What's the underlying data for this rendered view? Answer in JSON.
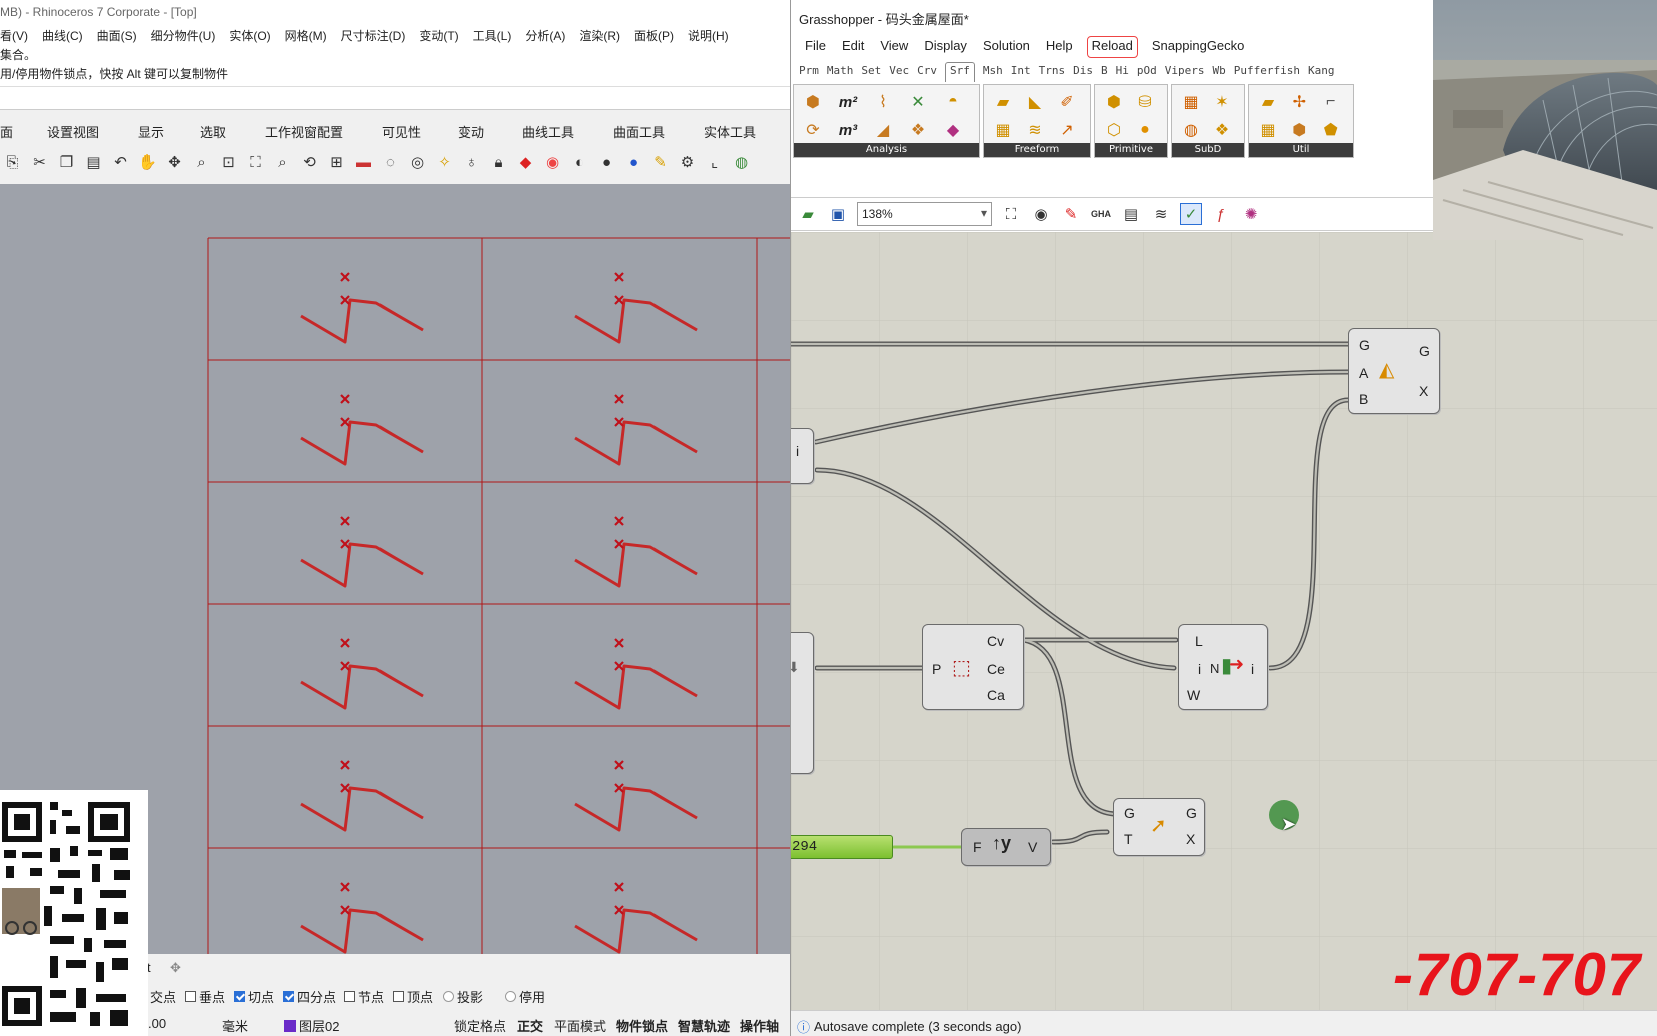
{
  "rhino": {
    "title": "MB) - Rhinoceros 7 Corporate - [Top]",
    "menu": [
      "看(V)",
      "曲线(C)",
      "曲面(S)",
      "细分物件(U)",
      "实体(O)",
      "网格(M)",
      "尺寸标注(D)",
      "变动(T)",
      "工具(L)",
      "分析(A)",
      "渲染(R)",
      "面板(P)",
      "说明(H)"
    ],
    "command_history": [
      "集合。",
      "用/停用物件锁点，快按 Alt 键可以复制物件"
    ],
    "tabs": [
      "面",
      "设置视图",
      "显示",
      "选取",
      "工作视窗配置",
      "可见性",
      "变动",
      "曲线工具",
      "曲面工具",
      "实体工具"
    ],
    "viewport_tab": "t",
    "snaps": [
      {
        "label": "交点",
        "checked": false
      },
      {
        "label": "垂点",
        "checked": false
      },
      {
        "label": "切点",
        "checked": true
      },
      {
        "label": "四分点",
        "checked": true
      },
      {
        "label": "节点",
        "checked": false
      },
      {
        "label": "顶点",
        "checked": false
      },
      {
        "label": "投影",
        "checked": false
      },
      {
        "label": "停用",
        "checked": false
      }
    ],
    "status": {
      "coord": ".00",
      "unit": "毫米",
      "layer": "图层02",
      "layer_color": "#6a2bc8",
      "lock_grid": "锁定格点",
      "ortho": "正交",
      "planar": "平面模式",
      "osnap": "物件锁点",
      "smarttrack": "智慧轨迹",
      "gumball": "操作轴"
    }
  },
  "gh": {
    "title": "Grasshopper - 码头金属屋面*",
    "menu": [
      "File",
      "Edit",
      "View",
      "Display",
      "Solution",
      "Help",
      "Reload",
      "SnappingGecko"
    ],
    "tabs": [
      "Prm",
      "Math",
      "Set",
      "Vec",
      "Crv",
      "Srf",
      "Msh",
      "Int",
      "Trns",
      "Dis",
      "B",
      "Hi",
      "pOd",
      "Vipers",
      "Wb",
      "Pufferfish",
      "Kang"
    ],
    "active_tab": "Srf",
    "panels": [
      "Analysis",
      "Freeform",
      "Primitive",
      "SubD",
      "Util"
    ],
    "zoom": "138%",
    "status": "Autosave complete (3 seconds ago)",
    "components": {
      "c1": {
        "inputs": [
          "G",
          "A",
          "B"
        ],
        "outputs": [
          "G",
          "X"
        ]
      },
      "c2": {
        "inputs": [
          "P"
        ],
        "outputs": [
          "Cv",
          "Ce",
          "Ca"
        ]
      },
      "c3": {
        "inputs": [
          "L",
          "i",
          "W"
        ],
        "outputs": [
          "i"
        ],
        "center": "N"
      },
      "c4": {
        "inputs": [
          "G",
          "T"
        ],
        "outputs": [
          "G",
          "X"
        ]
      },
      "c5": {
        "input": "F",
        "output": "V"
      },
      "c6": {
        "output": "i"
      },
      "slider": {
        "value": "294"
      }
    }
  },
  "overlay": {
    "red_text": "-707-707"
  }
}
